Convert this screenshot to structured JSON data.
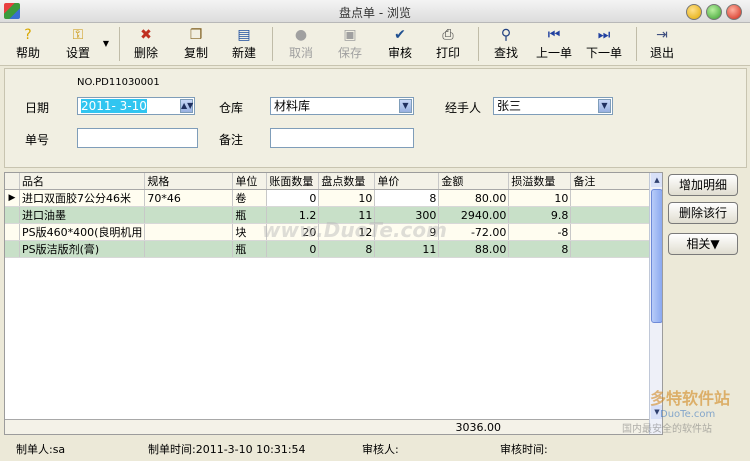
{
  "window": {
    "title": "盘点单 - 浏览"
  },
  "toolbar": {
    "help": "帮助",
    "settings": "设置",
    "delete": "删除",
    "copy": "复制",
    "new": "新建",
    "cancel": "取消",
    "save": "保存",
    "audit": "审核",
    "print": "打印",
    "find": "查找",
    "prev": "上一单",
    "next": "下一单",
    "exit": "退出"
  },
  "form": {
    "doc_no": "NO.PD11030001",
    "date_label": "日期",
    "date_value": "2011- 3-10",
    "warehouse_label": "仓库",
    "warehouse_value": "材料库",
    "handler_label": "经手人",
    "handler_value": "张三",
    "number_label": "单号",
    "number_value": "",
    "remark_label": "备注",
    "remark_value": ""
  },
  "grid": {
    "headers": [
      "品名",
      "规格",
      "单位",
      "账面数量",
      "盘点数量",
      "单价",
      "金额",
      "损溢数量",
      "备注"
    ],
    "rows": [
      [
        "进口双面胶7公分46米",
        "70*46",
        "卷",
        "0",
        "10",
        "8",
        "80.00",
        "10",
        ""
      ],
      [
        "进口油墨",
        "",
        "瓶",
        "1.2",
        "11",
        "300",
        "2940.00",
        "9.8",
        ""
      ],
      [
        "PS版460*400(良明机用",
        "",
        "块",
        "20",
        "12",
        "9",
        "-72.00",
        "-8",
        ""
      ],
      [
        "PS版洁版剂(膏)",
        "",
        "瓶",
        "0",
        "8",
        "11",
        "88.00",
        "8",
        ""
      ]
    ],
    "total_amount": "3036.00"
  },
  "side": {
    "add_detail": "增加明细",
    "delete_row": "删除该行",
    "related": "相关▼"
  },
  "status": {
    "creator": "制单人:sa",
    "created_time": "制单时间:2011-3-10 10:31:54",
    "auditor": "审核人:",
    "audit_time": "审核时间:"
  },
  "watermark": {
    "brand": "多特软件站",
    "site": "DuoTe.com",
    "slogan": "国内最安全的软件站",
    "overlay": "www.DuoTe.com"
  }
}
